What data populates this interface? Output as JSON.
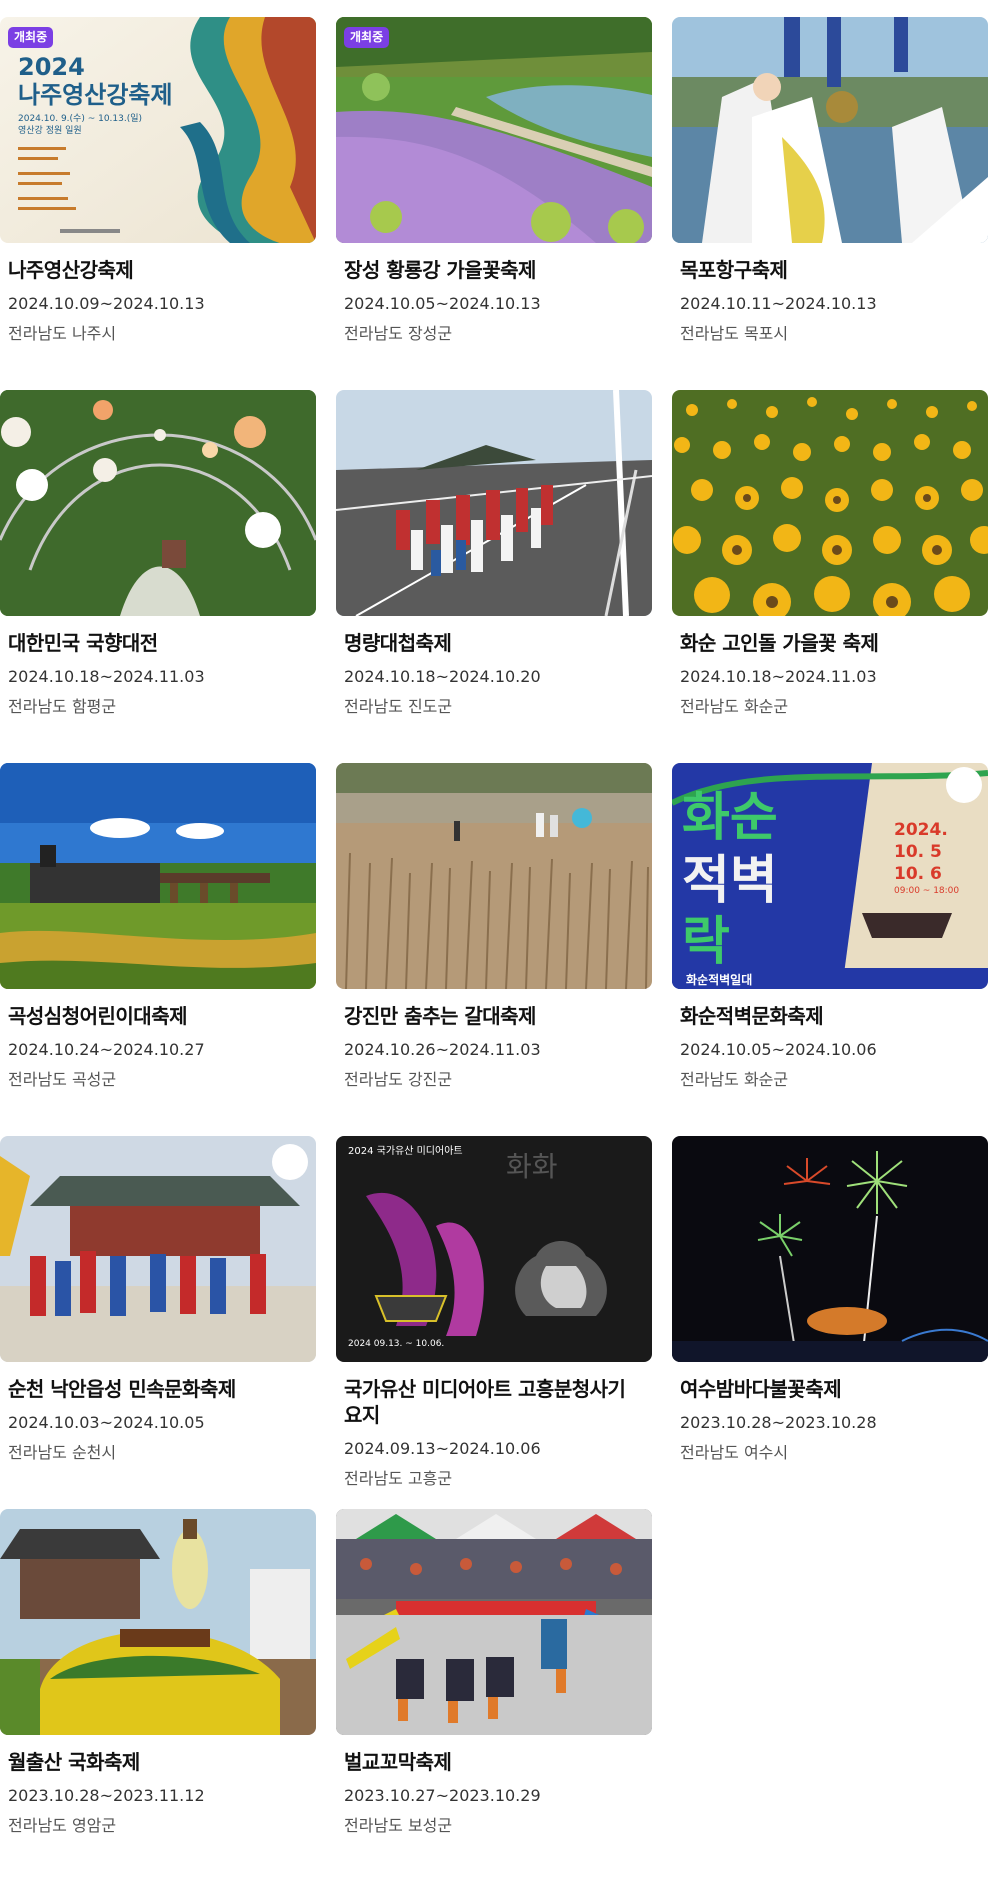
{
  "status_badge": "개최중",
  "festivals": [
    {
      "title": "나주영산강축제",
      "date": "2024.10.09~2024.10.13",
      "region": "전라남도 나주시",
      "badge": "개최중",
      "image": "poster-image"
    },
    {
      "title": "장성 황룡강 가을꽃축제",
      "date": "2024.10.05~2024.10.13",
      "region": "전라남도 장성군",
      "badge": "개최중",
      "image": "flower-river-image"
    },
    {
      "title": "목포항구축제",
      "date": "2024.10.11~2024.10.13",
      "region": "전라남도 목포시",
      "badge": "",
      "image": "performers-image"
    },
    {
      "title": "대한민국 국향대전",
      "date": "2024.10.18~2024.11.03",
      "region": "전라남도 함평군",
      "badge": "",
      "image": "lantern-tunnel-image"
    },
    {
      "title": "명량대첩축제",
      "date": "2024.10.18~2024.10.20",
      "region": "전라남도 진도군",
      "badge": "",
      "image": "bridge-parade-image"
    },
    {
      "title": "화순 고인돌 가을꽃 축제",
      "date": "2024.10.18~2024.11.03",
      "region": "전라남도 화순군",
      "badge": "",
      "image": "sunflower-field-image"
    },
    {
      "title": "곡성심청어린이대축제",
      "date": "2024.10.24~2024.10.27",
      "region": "전라남도 곡성군",
      "badge": "",
      "image": "steam-train-image"
    },
    {
      "title": "강진만 춤추는 갈대축제",
      "date": "2024.10.26~2024.11.03",
      "region": "전라남도 강진군",
      "badge": "",
      "image": "reed-field-image"
    },
    {
      "title": "화순적벽문화축제",
      "date": "2024.10.05~2024.10.06",
      "region": "전라남도 화순군",
      "badge": "",
      "image": "poster-image"
    },
    {
      "title": "순천 낙안읍성 민속문화축제",
      "date": "2024.10.03~2024.10.05",
      "region": "전라남도 순천시",
      "badge": "",
      "image": "folk-procession-image"
    },
    {
      "title": "국가유산 미디어아트 고흥분청사기 요지",
      "date": "2024.09.13~2024.10.06",
      "region": "전라남도 고흥군",
      "badge": "",
      "image": "media-art-poster-image"
    },
    {
      "title": "여수밤바다불꽃축제",
      "date": "2023.10.28~2023.10.28",
      "region": "전라남도 여수시",
      "badge": "",
      "image": "fireworks-image"
    },
    {
      "title": "월출산 국화축제",
      "date": "2023.10.28~2023.11.12",
      "region": "전라남도 영암군",
      "badge": "",
      "image": "chrysanthemum-image"
    },
    {
      "title": "벌교꼬막축제",
      "date": "2023.10.27~2023.10.29",
      "region": "전라남도 보성군",
      "badge": "",
      "image": "mudflat-game-image"
    }
  ],
  "poster_text": {
    "nju_year": "2024",
    "nju_name": "나주영산강축제",
    "nju_dates": "2024.10. 9.(수) ~ 10.13.(일)",
    "nju_venue": "영산강 정원 일원",
    "hs_big1": "화순",
    "hs_big2": "적벽",
    "hs_big3": "락",
    "hs_year": "2024.",
    "hs_d1": "10. 5",
    "hs_d2": "10. 6",
    "hs_time": "09:00 ~ 18:00",
    "hs_venue": "화순적벽일대",
    "ma_head": "2024 국가유산 미디어아트",
    "ma_big": "화화",
    "ma_date": "2024 09.13. ~ 10.06."
  },
  "colors": {
    "badge": "#7b3fe4",
    "title": "#111111",
    "date": "#333333",
    "region": "#555555"
  }
}
